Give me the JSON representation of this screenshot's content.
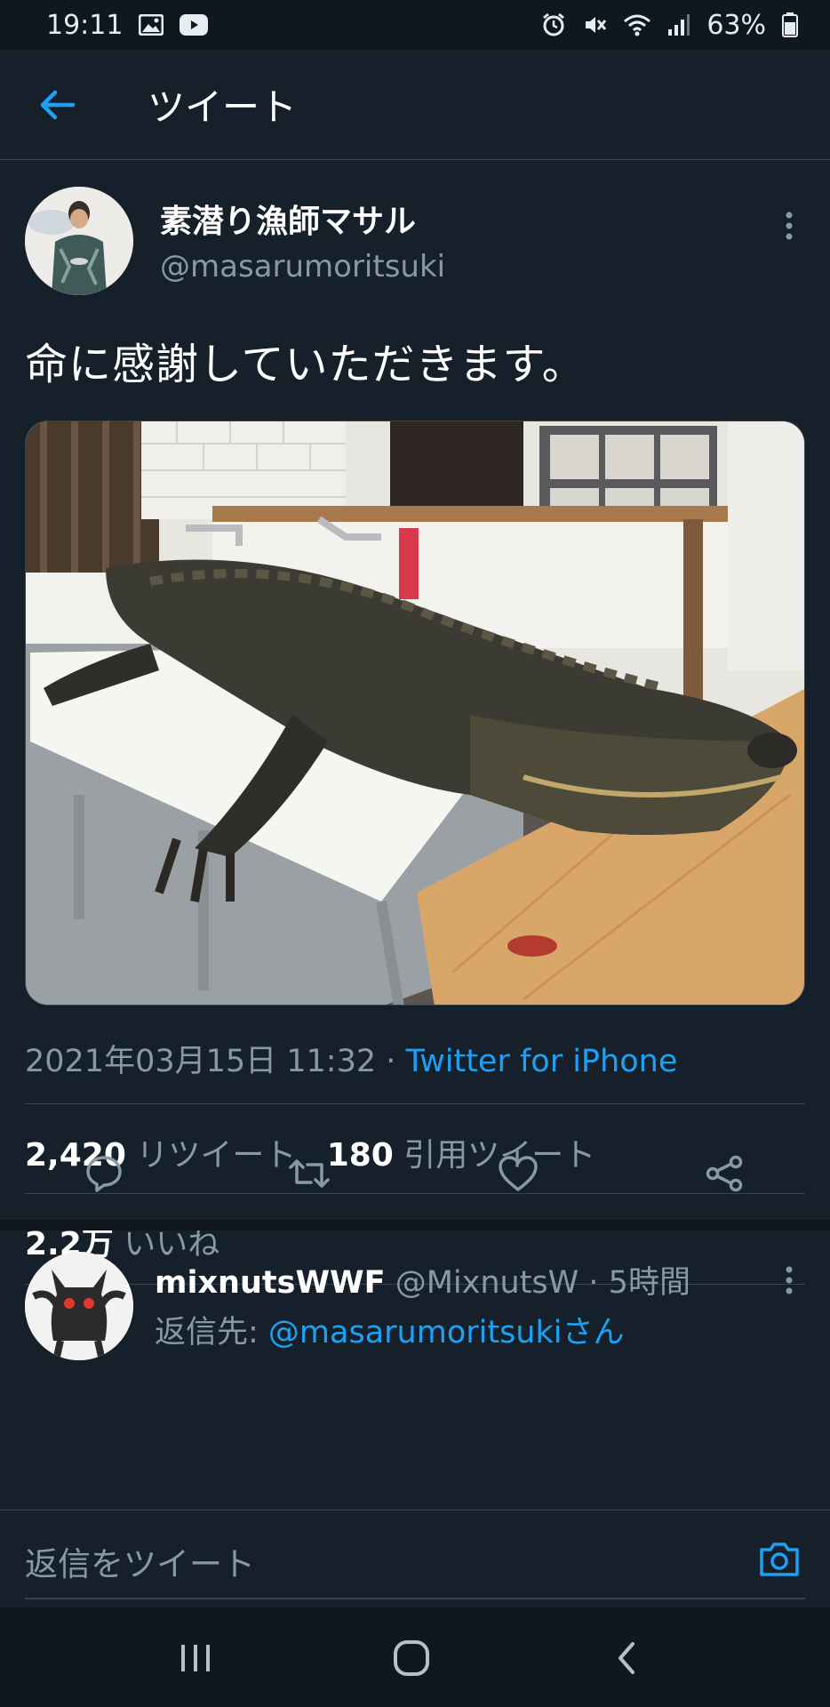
{
  "status_bar": {
    "time": "19:11",
    "battery": "63%",
    "left_icons": [
      "image-icon",
      "youtube-icon"
    ],
    "right_icons": [
      "alarm-icon",
      "mute-icon",
      "wifi-icon",
      "signal-icon",
      "battery-icon"
    ]
  },
  "header": {
    "title": "ツイート",
    "back_icon": "back-arrow-icon"
  },
  "tweet": {
    "author_name": "素潜り漁師マサル",
    "author_handle": "@masarumoritsuki",
    "text": "命に感謝していただきます。",
    "media_alt": "alligator on cutting table",
    "timestamp": "2021年03月15日 11:32",
    "separator": " · ",
    "source": "Twitter for iPhone",
    "retweets_count": "2,420",
    "retweets_label": "リツイート",
    "quotes_count": "180",
    "quotes_label": "引用ツイート",
    "likes_count": "2.2万",
    "likes_label": "いいね",
    "actions": [
      "reply-icon",
      "retweet-icon",
      "like-icon",
      "share-icon"
    ]
  },
  "reply": {
    "author_name": "mixnutsWWF",
    "author_handle": "@MixnutsW",
    "separator": " · ",
    "time": "5時間",
    "reply_to_label": "返信先: ",
    "reply_to_handle": "@masarumoritsukiさん"
  },
  "composer": {
    "placeholder": "返信をツイート",
    "camera_icon": "camera-icon"
  },
  "nav": {
    "buttons": [
      "recent-apps-icon",
      "home-icon",
      "back-icon"
    ]
  },
  "colors": {
    "background": "#15202b",
    "accent": "#1da1f2",
    "secondary_text": "#8899a6",
    "divider": "#38444d"
  }
}
